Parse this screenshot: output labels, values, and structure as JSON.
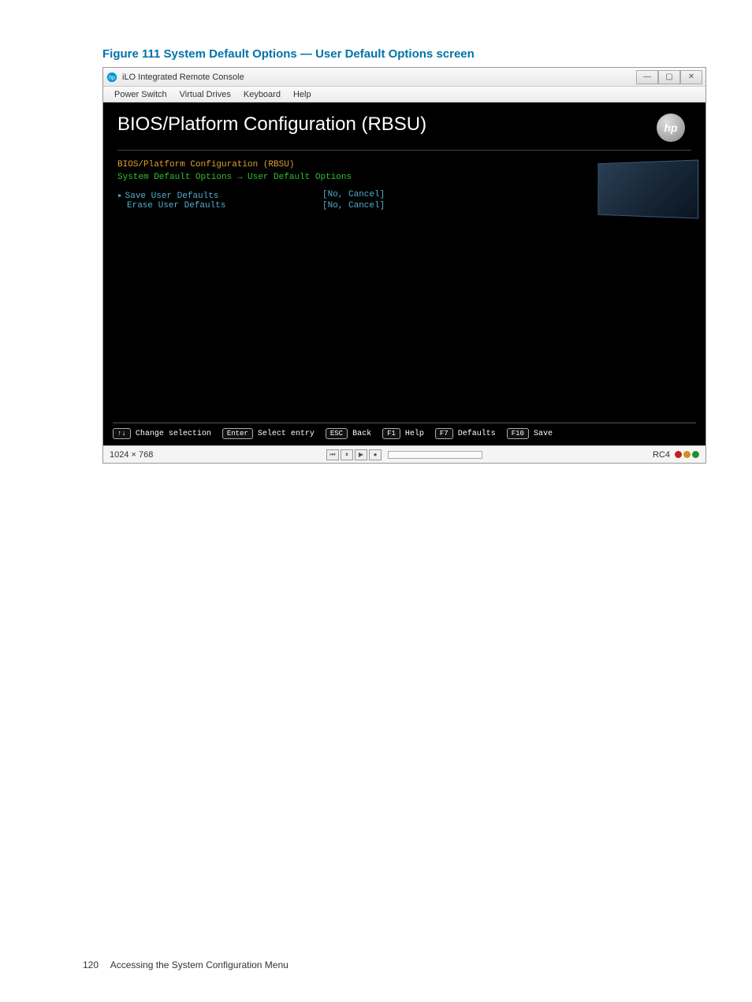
{
  "figure": {
    "caption": "Figure 111 System Default Options — User Default Options screen"
  },
  "titlebar": {
    "title": "iLO Integrated Remote Console",
    "minimize": "—",
    "maximize": "▢",
    "close": "✕"
  },
  "menubar": {
    "items": [
      "Power Switch",
      "Virtual Drives",
      "Keyboard",
      "Help"
    ]
  },
  "bios": {
    "title": "BIOS/Platform Configuration (RBSU)",
    "logo_text": "hp",
    "breadcrumb1": "BIOS/Platform Configuration (RBSU)",
    "breadcrumb2_a": "System Default Options",
    "breadcrumb2_sep": " → ",
    "breadcrumb2_b": "User Default Options",
    "options": [
      {
        "label": "Save User Defaults",
        "value": "[No, Cancel]",
        "selected": true
      },
      {
        "label": "Erase User Defaults",
        "value": "[No, Cancel]",
        "selected": false
      }
    ],
    "keys": [
      {
        "key": "↑↓",
        "label": "Change selection"
      },
      {
        "key": "Enter",
        "label": "Select entry"
      },
      {
        "key": "ESC",
        "label": "Back"
      },
      {
        "key": "F1",
        "label": "Help"
      },
      {
        "key": "F7",
        "label": "Defaults"
      },
      {
        "key": "F10",
        "label": "Save"
      }
    ]
  },
  "statusbar": {
    "resolution": "1024 × 768",
    "rc_label": "RC4",
    "ctrl_rewind": "⏮",
    "ctrl_pause": "⏸",
    "ctrl_play": "▶",
    "ctrl_record": "●"
  },
  "footer": {
    "page": "120",
    "section": "Accessing the System Configuration Menu"
  }
}
